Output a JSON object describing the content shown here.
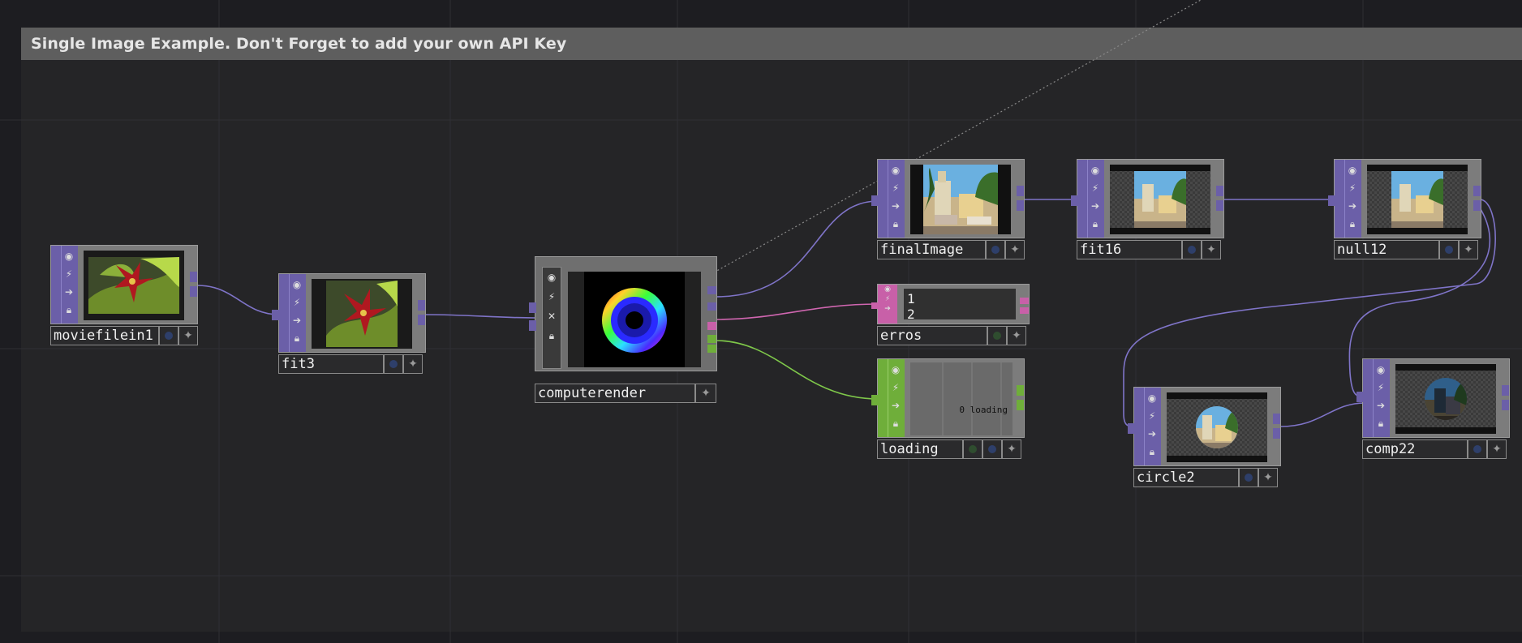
{
  "annotation": {
    "title": "Single Image Example. Don't Forget to add your own API Key"
  },
  "colors": {
    "top": "#6b5fa8",
    "dat": "#c860a8",
    "chop": "#6fae3a"
  },
  "nodes": {
    "moviefilein1": {
      "name": "moviefilein1"
    },
    "fit3": {
      "name": "fit3"
    },
    "computerender": {
      "name": "computerender"
    },
    "finalImage": {
      "name": "finalImage"
    },
    "fit16": {
      "name": "fit16"
    },
    "null12": {
      "name": "null12"
    },
    "erros": {
      "name": "erros",
      "line1": "1",
      "line2": "2"
    },
    "loading": {
      "name": "loading",
      "status": "0 loading"
    },
    "circle2": {
      "name": "circle2"
    },
    "comp22": {
      "name": "comp22"
    }
  }
}
